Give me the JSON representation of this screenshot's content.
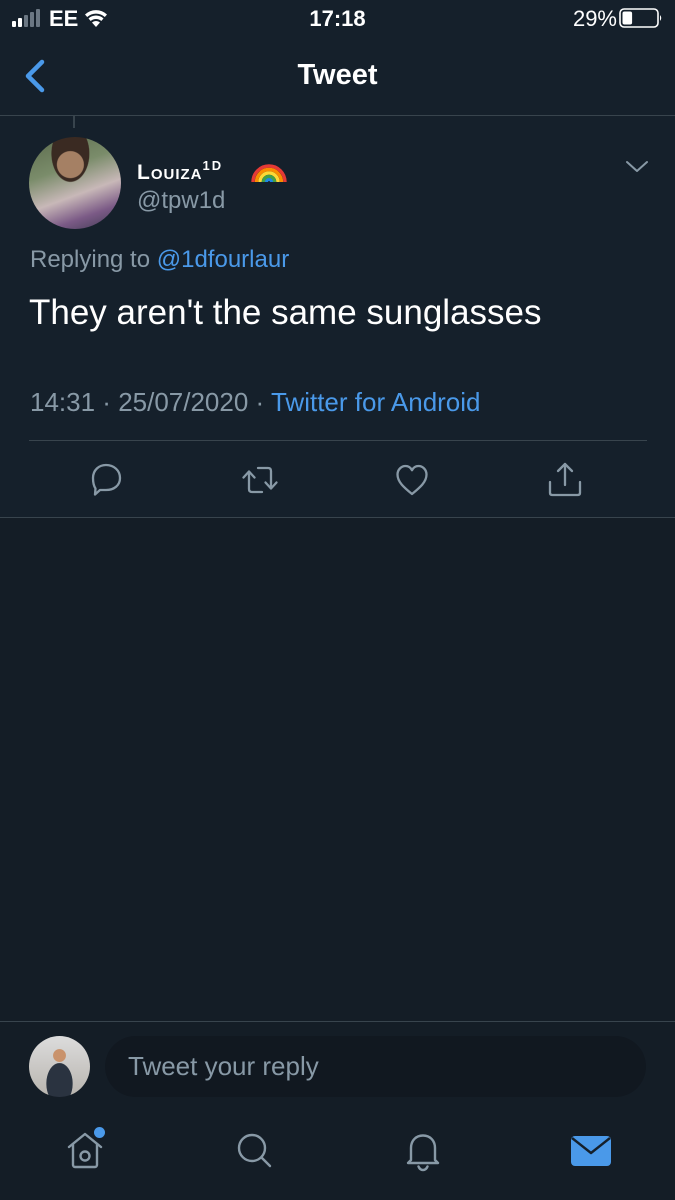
{
  "status_bar": {
    "carrier": "EE",
    "time": "17:18",
    "battery_percent": "29%",
    "battery_level": 0.29
  },
  "header": {
    "title": "Tweet",
    "back_icon": "chevron-left-icon"
  },
  "tweet": {
    "display_name": "Louiza",
    "display_name_superscript": "1D",
    "display_name_emoji": "rainbow-emoji",
    "handle": "@tpw1d",
    "replying_prefix": "Replying to",
    "replying_to": "@1dfourlaur",
    "text": "They aren't the same sunglasses",
    "time": "14:31",
    "date": "25/07/2020",
    "source": "Twitter for Android",
    "actions": [
      "reply-icon",
      "retweet-icon",
      "like-icon",
      "share-icon"
    ]
  },
  "composer": {
    "placeholder": "Tweet your reply"
  },
  "tabbar": {
    "items": [
      "home-icon",
      "search-icon",
      "notifications-icon",
      "messages-icon"
    ],
    "active": "messages-icon"
  },
  "colors": {
    "background": "#15202b",
    "background_dark": "#141d26",
    "accent": "#4a99e9",
    "secondary_text": "#8899a6",
    "divider": "#38444d"
  }
}
